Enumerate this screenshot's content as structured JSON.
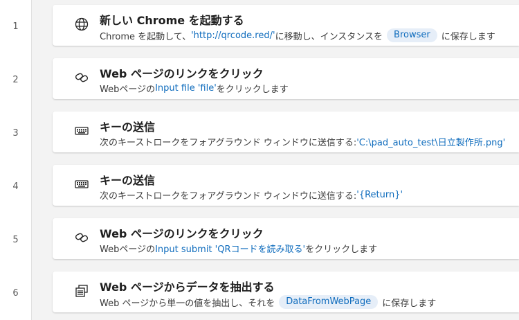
{
  "steps": [
    {
      "number": "1",
      "icon": "globe-icon",
      "title": "新しい Chrome を起動する",
      "desc_prefix": "Chrome を起動して、",
      "desc_link": "'http://qrcode.red/'",
      "desc_mid": " に移動し、インスタンスを",
      "desc_pill": "Browser",
      "desc_suffix": "に保存します"
    },
    {
      "number": "2",
      "icon": "link-icon",
      "title": "Web ページのリンクをクリック",
      "desc_prefix": "Webページの ",
      "desc_link": "Input file 'file'",
      "desc_suffix": " をクリックします"
    },
    {
      "number": "3",
      "icon": "keyboard-icon",
      "title": "キーの送信",
      "desc_prefix": "次のキーストロークをフォアグラウンド ウィンドウに送信する: ",
      "desc_link": "'C:\\pad_auto_test\\日立製作所.png'"
    },
    {
      "number": "4",
      "icon": "keyboard-icon",
      "title": "キーの送信",
      "desc_prefix": "次のキーストロークをフォアグラウンド ウィンドウに送信する: ",
      "desc_link": "'{Return}'"
    },
    {
      "number": "5",
      "icon": "link-icon",
      "title": "Web ページのリンクをクリック",
      "desc_prefix": "Webページの ",
      "desc_link": "Input submit 'QRコードを読み取る'",
      "desc_suffix": " をクリックします"
    },
    {
      "number": "6",
      "icon": "extract-data-icon",
      "title": "Web ページからデータを抽出する",
      "desc_prefix": "Web ページから単一の値を抽出し、それを",
      "desc_pill": "DataFromWebPage",
      "desc_suffix": "に保存します"
    }
  ]
}
